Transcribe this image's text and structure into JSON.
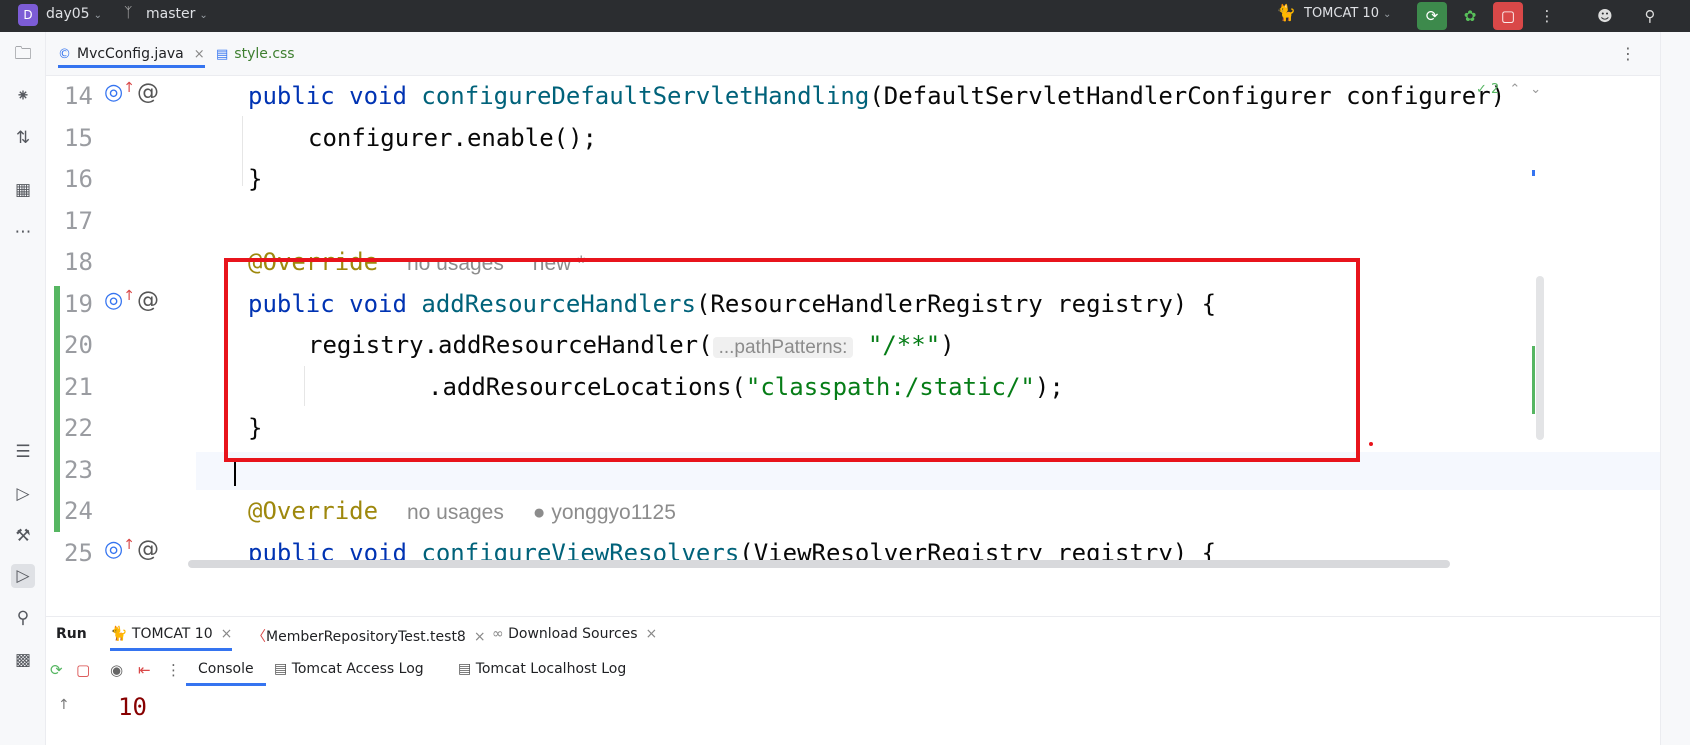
{
  "titlebar": {
    "project_badge": "D",
    "project": "day05",
    "branch": "master",
    "run_config": "TOMCAT 10",
    "icons": [
      "branch-icon",
      "cat-icon",
      "rerun-icon",
      "debug-icon",
      "stop-icon",
      "more-icon",
      "add-user-icon",
      "search-icon"
    ],
    "colors": {
      "background": "#2b2d30",
      "rerun": "#3d8a4c",
      "stop": "#d94848"
    }
  },
  "left_toolbar": {
    "icons": [
      "folder-icon",
      "commit-icon",
      "pull-request-icon",
      "structure-icon",
      "more-icon",
      "layers-icon",
      "services-icon",
      "build-icon",
      "run-icon",
      "find-icon",
      "terminal-icon"
    ]
  },
  "editor_tabs": [
    {
      "label": "MvcConfig.java",
      "active": true
    },
    {
      "label": "style.css",
      "active": false
    }
  ],
  "inspection": {
    "count": "2"
  },
  "editor": {
    "lines": [
      {
        "num": "14",
        "gutter": true
      },
      {
        "num": "15",
        "gutter": false
      },
      {
        "num": "16",
        "gutter": false
      },
      {
        "num": "17",
        "gutter": false
      },
      {
        "num": "18",
        "gutter": false
      },
      {
        "num": "19",
        "gutter": true
      },
      {
        "num": "20",
        "gutter": false
      },
      {
        "num": "21",
        "gutter": false
      },
      {
        "num": "22",
        "gutter": false
      },
      {
        "num": "23",
        "gutter": false
      },
      {
        "num": "24",
        "gutter": false
      },
      {
        "num": "25",
        "gutter": true
      }
    ],
    "code": {
      "l14_kw": "public void ",
      "l14_fn": "configureDefaultServletHandling",
      "l14_rest": "(DefaultServletHandlerConfigurer configurer)",
      "l15": "configurer.enable();",
      "l16": "}",
      "l18_ann": "@Override",
      "l18_hint1": "no usages",
      "l18_hint2": "new *",
      "l19_kw": "public void ",
      "l19_fn": "addResourceHandlers",
      "l19_rest": "(ResourceHandlerRegistry registry) {",
      "l20_pre": "registry.addResourceHandler(",
      "l20_hint": "...pathPatterns:",
      "l20_str": "\"/**\"",
      "l20_post": ")",
      "l21_pre": ".addResourceLocations(",
      "l21_str": "\"classpath:/static/\"",
      "l21_post": ");",
      "l22": "}",
      "l24_ann": "@Override",
      "l24_hint1": "no usages",
      "l24_author": "yonggyo1125",
      "l25_kw": "public void ",
      "l25_fn": "configureViewResolvers",
      "l25_rest": "(ViewResolverRegistry registry) {"
    }
  },
  "run_panel": {
    "title": "Run",
    "tabs": [
      {
        "label": "TOMCAT 10"
      },
      {
        "label": "MemberRepositoryTest.test8"
      },
      {
        "label": "Download Sources"
      }
    ],
    "console_tabs": [
      {
        "label": "Console"
      },
      {
        "label": "Tomcat Access Log"
      },
      {
        "label": "Tomcat Localhost Log"
      }
    ],
    "output_line": "10"
  }
}
